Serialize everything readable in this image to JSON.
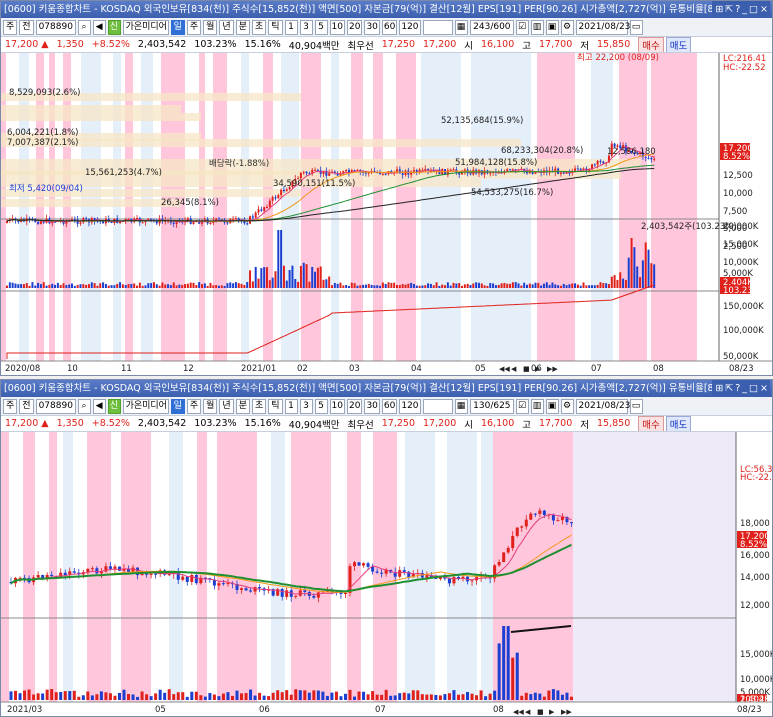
{
  "colors": {
    "up": "#e0201a",
    "down": "#1b3fd0",
    "pink": "#ffc6dc",
    "light": "#e5effa",
    "lav": "#eeeaf8"
  },
  "top": {
    "title": "[0600] 키움종합차트 - KOSDAQ 외국인보유[834(천)] 주식수[15,852(천)] 액면[500] 자본금[79(억)] 결산[12월] EPS[191] PER[90.26] 시가총액[2,727(억)] 유통비율[81.",
    "toolbar": {
      "type": "주",
      "sub": "전",
      "code": "078890",
      "name": "가온미디어",
      "tabs": [
        "일",
        "주",
        "월",
        "년",
        "분",
        "초",
        "틱"
      ],
      "periods": [
        "1",
        "3",
        "5",
        "10",
        "20",
        "30",
        "60",
        "120"
      ],
      "range": "243/600",
      "date": "2021/08/23"
    },
    "info": {
      "price": "17,200 ▲",
      "change": "1,350",
      "pct": "+8.52%",
      "volume": "2,403,542",
      "ratio": "103.23%",
      "turnover": "15.16%",
      "amount": "40,904백만",
      "bestask_label": "최우선",
      "bestask": "17,250",
      "bestbid": "17,200",
      "open_label": "시",
      "open": "16,100",
      "high_label": "고",
      "high": "17,700",
      "low_label": "저",
      "low": "15,850",
      "buy": "매수",
      "sell": "매도"
    },
    "yaxis": [
      "LC:216.41",
      "HC:-22.52",
      "17,200",
      "8.52%",
      "12,500",
      "10,000",
      "7,500",
      "5,000",
      "2,500"
    ],
    "yaxis_upper": [
      "15,000",
      "17,500",
      "20,000"
    ],
    "vol_axis": [
      "20,000K",
      "15,000K",
      "10,000K",
      "5,000K",
      "2,404K",
      "103.23%"
    ],
    "obv_axis": [
      "150,000K",
      "100,000K",
      "50,000K"
    ],
    "labels": {
      "high": "최고 22,200 (08/09)",
      "low": "최저 5,420(09/04)",
      "dividend": "배당락(-1.88%)",
      "vol": "2,403,542주(103.23%)",
      "vp": [
        "8,529,093(2.6%)",
        "6,004,221(1.8%)",
        "7,007,387(2.1%)",
        "15,561,253(4.7%)",
        "52,135,684(15.9%)",
        "68,233,304(20.8%)",
        "51,984,128(15.8%)",
        "34,590,151(11.5%)",
        "12,586,180",
        "54,533,275(16.7%)",
        "26,345(8.1%)"
      ]
    },
    "xaxis": [
      "2020/08",
      "10",
      "11",
      "12",
      "2021/01",
      "02",
      "03",
      "04",
      "05",
      "06",
      "07",
      "08",
      "08/23"
    ]
  },
  "bottom": {
    "title": "[0600] 키움종합차트 - KOSDAQ 외국인보유[834(천)] 주식수[15,852(천)] 액면[500] 자본금[79(억)] 결산[12월] EPS[191] PER[90.26] 시가총액[2,727(억)] 유통비율[81.",
    "toolbar": {
      "type": "주",
      "sub": "전",
      "code": "078890",
      "name": "가온미디어",
      "tabs": [
        "일",
        "주",
        "월",
        "년",
        "분",
        "초",
        "틱"
      ],
      "periods": [
        "1",
        "3",
        "5",
        "10",
        "20",
        "30",
        "60",
        "120"
      ],
      "range": "130/625",
      "date": "2021/08/23"
    },
    "info": {
      "price": "17,200 ▲",
      "change": "1,350",
      "pct": "+8.52%",
      "volume": "2,403,542",
      "ratio": "103.23%",
      "turnover": "15.16%",
      "amount": "40,904백만",
      "bestask_label": "최우선",
      "bestask": "17,250",
      "bestbid": "17,200",
      "open_label": "시",
      "open": "16,100",
      "high_label": "고",
      "high": "17,700",
      "low_label": "저",
      "low": "15,850",
      "buy": "매수",
      "sell": "매도"
    },
    "yaxis": [
      "LC:56.36",
      "HC:-22.52",
      "18,000",
      "17,200",
      "8.52%",
      "16,000",
      "14,000",
      "12,000"
    ],
    "vol_axis": [
      "15,000K",
      "10,000K",
      "5,000K",
      "2,404K",
      "103.23%"
    ],
    "xaxis": [
      "2021/03",
      "05",
      "06",
      "07",
      "08",
      "08/23"
    ]
  },
  "icons": [
    "window-icon",
    "pin-icon",
    "help-icon",
    "minimize-icon",
    "maximize-icon",
    "close-icon"
  ]
}
